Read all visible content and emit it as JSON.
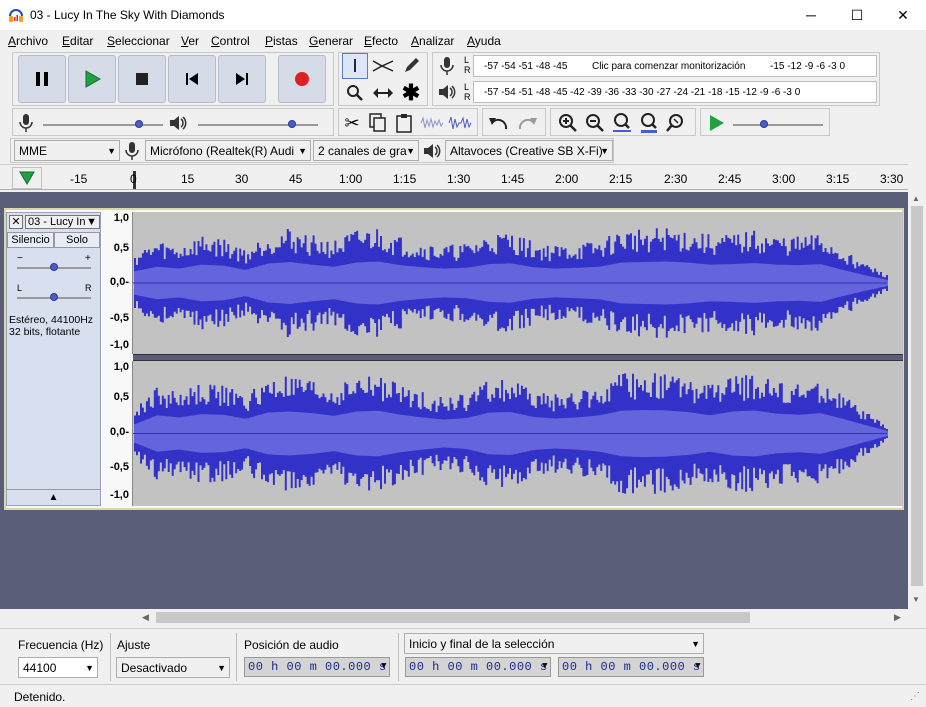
{
  "window": {
    "title": "03 - Lucy In The Sky With Diamonds",
    "minimize": "─",
    "maximize": "☐",
    "close": "✕"
  },
  "menu": [
    "Archivo",
    "Editar",
    "Seleccionar",
    "Ver",
    "Control",
    "Pistas",
    "Generar",
    "Efecto",
    "Analizar",
    "Ayuda"
  ],
  "meters": {
    "record_scale_left": "-57 -54 -51 -48 -45",
    "record_hint": "Clic para comenzar monitorización",
    "record_scale_right": "-15 -12 -9 -6 -3 0",
    "play_scale": "-57 -54 -51 -48 -45 -42 -39 -36 -33 -30 -27 -24 -21 -18 -15 -12 -9 -6 -3 0",
    "lr_l": "L",
    "lr_r": "R"
  },
  "devices": {
    "host": "MME",
    "mic": "Micrófono (Realtek(R) Audi",
    "channels": "2 canales de gra",
    "speaker": "Altavoces (Creative SB X-Fi)"
  },
  "ruler": {
    "ticks": [
      "-15",
      "0",
      "15",
      "30",
      "45",
      "1:00",
      "1:15",
      "1:30",
      "1:45",
      "2:00",
      "2:15",
      "2:30",
      "2:45",
      "3:00",
      "3:15",
      "3:30"
    ]
  },
  "track": {
    "name": "03 - Lucy In",
    "mute": "Silencio",
    "solo": "Solo",
    "gain_minus": "−",
    "gain_plus": "+",
    "pan_l": "L",
    "pan_r": "R",
    "info_line1": "Estéreo, 44100Hz",
    "info_line2": "32 bits, flotante",
    "collapse": "▲",
    "scale": [
      "1,0",
      "0,5",
      "0,0-",
      "-0,5",
      "-1,0"
    ],
    "wave_color": "#3232c8",
    "peaks_top": [
      0.45,
      0.62,
      0.55,
      0.7,
      0.66,
      0.5,
      0.74,
      0.8,
      0.7,
      0.62,
      0.78,
      0.82,
      0.68,
      0.6,
      0.55,
      0.58,
      0.72,
      0.75,
      0.6,
      0.55,
      0.58,
      0.62,
      0.78,
      0.8,
      0.82,
      0.78,
      0.7,
      0.72,
      0.76,
      0.7,
      0.68,
      0.72,
      0.5,
      0.3,
      0.12
    ],
    "peaks_bottom": [
      0.35,
      0.68,
      0.6,
      0.72,
      0.7,
      0.55,
      0.78,
      0.82,
      0.76,
      0.66,
      0.82,
      0.85,
      0.7,
      0.6,
      0.52,
      0.58,
      0.78,
      0.8,
      0.62,
      0.56,
      0.6,
      0.68,
      0.85,
      0.88,
      0.86,
      0.8,
      0.68,
      0.82,
      0.86,
      0.74,
      0.7,
      0.76,
      0.55,
      0.32,
      0.1
    ]
  },
  "selection_toolbar": {
    "rate_label": "Frecuencia (Hz)",
    "rate_value": "44100",
    "snap_label": "Ajuste",
    "snap_value": "Desactivado",
    "position_label": "Posición de audio",
    "position_value": "00 h 00 m 00.000 s",
    "selection_label": "Inicio y final de la selección",
    "sel_start": "00 h 00 m 00.000 s",
    "sel_end": "00 h 00 m 00.000 s"
  },
  "status": {
    "text": "Detenido."
  },
  "colors": {
    "record": "#e02020",
    "play": "#20a040",
    "waveform": "#3232c8"
  }
}
